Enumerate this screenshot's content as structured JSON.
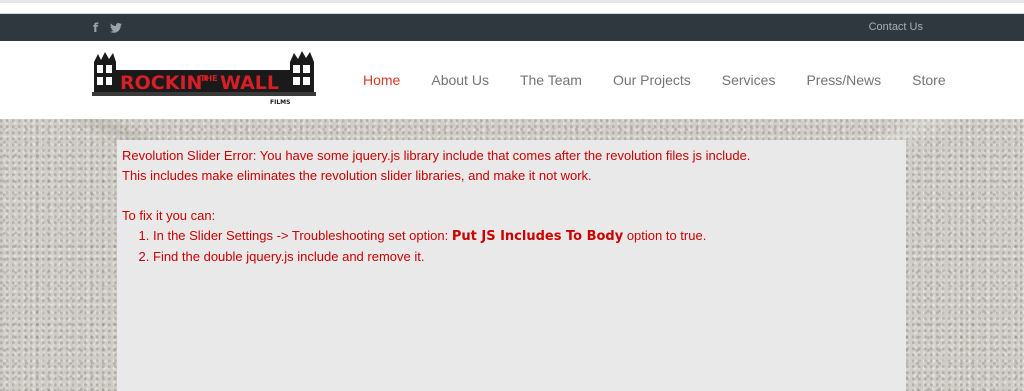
{
  "topbar": {
    "social_icons": [
      "facebook-icon",
      "twitter-icon"
    ],
    "contact_label": "Contact Us"
  },
  "logo": {
    "text_main": "ROCKIN'",
    "text_the": "THE",
    "text_wall": "WALL",
    "text_sub": "FILMS"
  },
  "nav": {
    "items": [
      "Home",
      "About Us",
      "The Team",
      "Our Projects",
      "Services",
      "Press/News",
      "Store"
    ],
    "active": "Home"
  },
  "error": {
    "line1": "Revolution Slider Error: You have some jquery.js library include that comes after the revolution files js include.",
    "line2": "This includes make eliminates the revolution slider libraries, and make it not work.",
    "fix_intro": "To fix it you can:",
    "step1_prefix": "In the Slider Settings -> Troubleshooting set option: ",
    "step1_bold": "Put JS Includes To Body",
    "step1_suffix": " option to true.",
    "step2": "Find the double jquery.js include and remove it."
  },
  "colors": {
    "topbar": "#2f383e",
    "nav_active": "#d13d2d",
    "nav_text": "#747474",
    "error_text": "#cc0000",
    "error_bg": "#e9e9e9"
  }
}
